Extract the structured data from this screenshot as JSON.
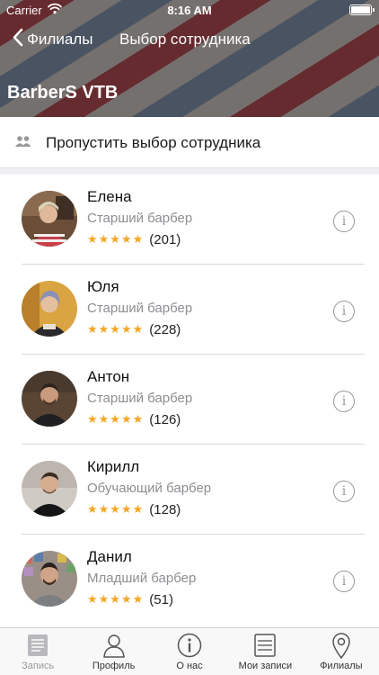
{
  "status_bar": {
    "carrier": "Carrier",
    "time": "8:16 AM"
  },
  "nav": {
    "back_label": "Филиалы",
    "title": "Выбор сотрудника"
  },
  "brand": "BarberS VTB",
  "skip": {
    "label": "Пропустить выбор сотрудника",
    "icon": "people-icon"
  },
  "colors": {
    "star": "#f5a623",
    "secondary_text": "#8e8e93",
    "separator": "#d9d9dc"
  },
  "staff": [
    {
      "name": "Елена",
      "role": "Старший барбер",
      "stars": "★★★★★",
      "rating": 5,
      "count": "(201)"
    },
    {
      "name": "Юля",
      "role": "Старший барбер",
      "stars": "★★★★★",
      "rating": 5,
      "count": "(228)"
    },
    {
      "name": "Антон",
      "role": "Старший барбер",
      "stars": "★★★★★",
      "rating": 5,
      "count": "(126)"
    },
    {
      "name": "Кирилл",
      "role": "Обучающий барбер",
      "stars": "★★★★★",
      "rating": 5,
      "count": "(128)"
    },
    {
      "name": "Данил",
      "role": "Младший барбер",
      "stars": "★★★★★",
      "rating": 5,
      "count": "(51)"
    }
  ],
  "tabs": [
    {
      "label": "Запись",
      "icon": "booking-icon",
      "active": true
    },
    {
      "label": "Профиль",
      "icon": "profile-icon",
      "active": false
    },
    {
      "label": "О нас",
      "icon": "info-icon",
      "active": false
    },
    {
      "label": "Мои записи",
      "icon": "list-icon",
      "active": false
    },
    {
      "label": "Филиалы",
      "icon": "location-pin-icon",
      "active": false
    }
  ]
}
